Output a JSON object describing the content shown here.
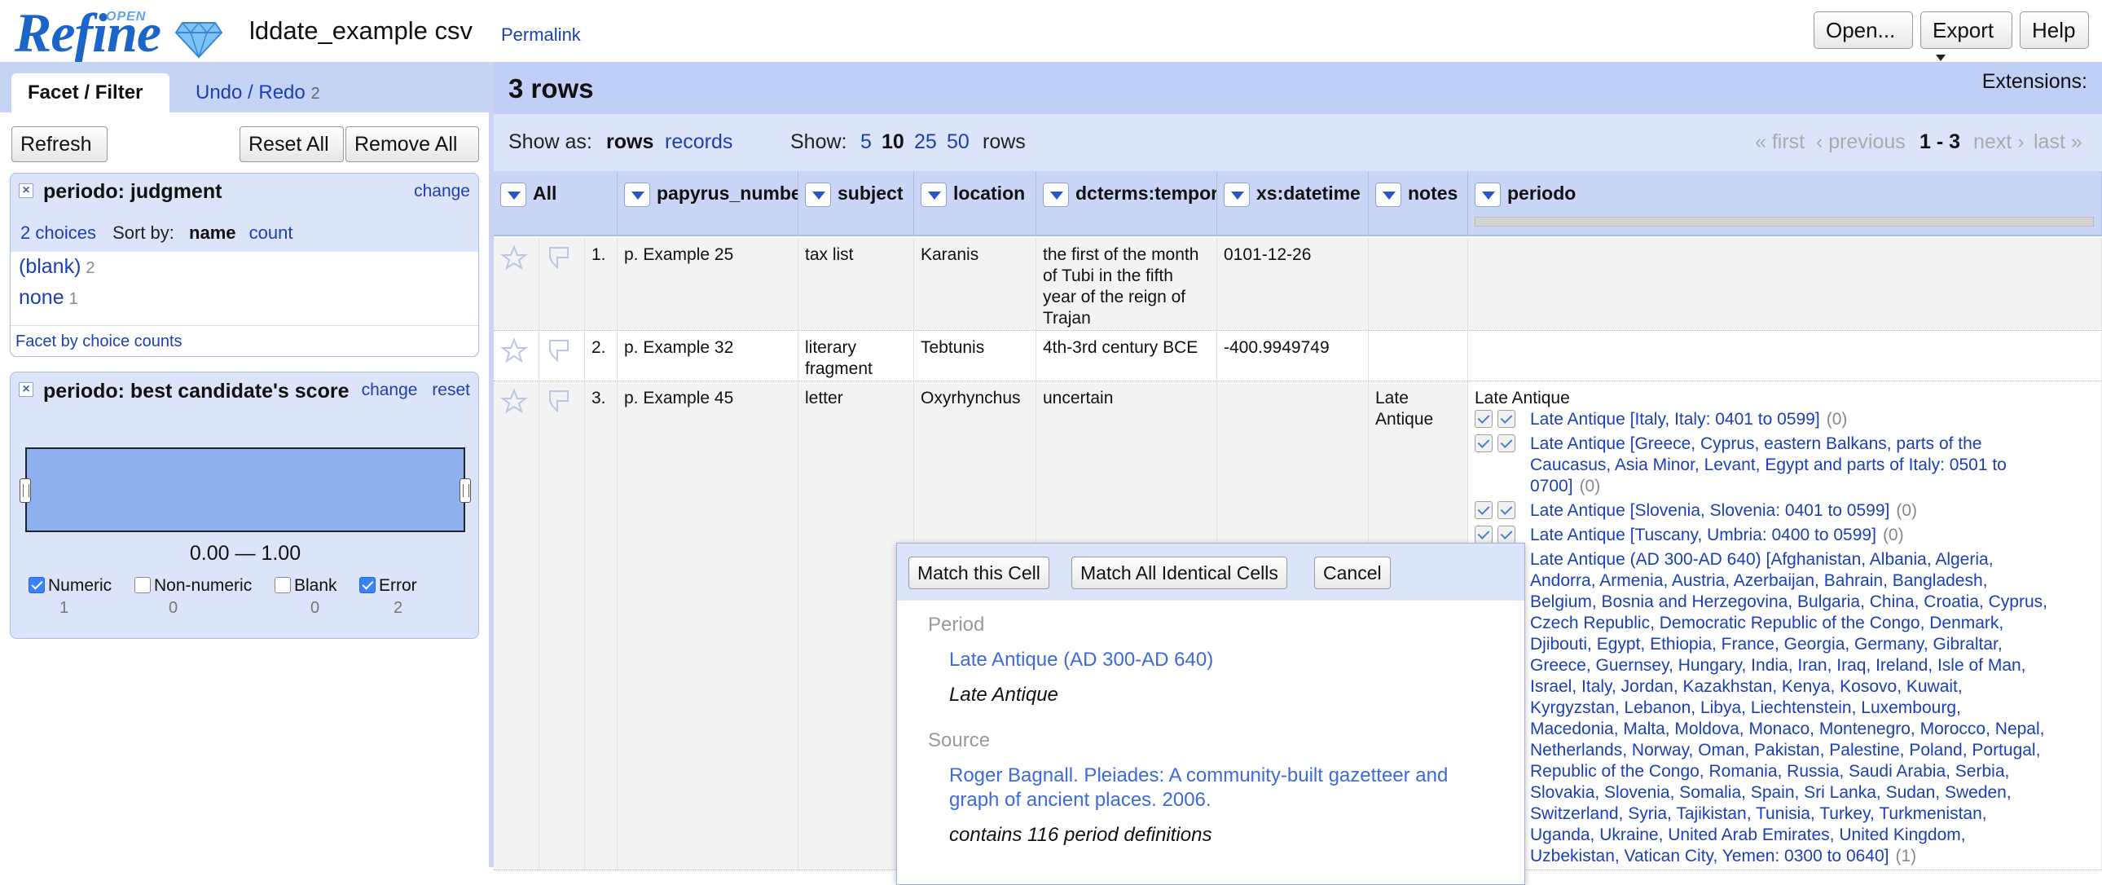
{
  "header": {
    "logo_open": "OPEN",
    "logo_refine": "Refine",
    "project_title": "lddate_example csv",
    "permalink": "Permalink",
    "open_button": "Open...",
    "export_button": "Export",
    "help_button": "Help"
  },
  "left_panel": {
    "tabs": {
      "facet_filter": "Facet / Filter",
      "undo_redo": "Undo / Redo",
      "undo_count": "2"
    },
    "refresh": "Refresh",
    "reset_all": "Reset All",
    "remove_all": "Remove All",
    "facet1": {
      "title": "periodo: judgment",
      "change": "change",
      "choices": "2 choices",
      "sort_by": "Sort by:",
      "sort_name": "name",
      "sort_count": "count",
      "items": [
        {
          "label": "(blank)",
          "count": "2"
        },
        {
          "label": "none",
          "count": "1"
        }
      ],
      "footer": "Facet by choice counts"
    },
    "facet2": {
      "title": "periodo: best candidate's score",
      "change": "change",
      "reset": "reset",
      "range": "0.00 — 1.00",
      "checkboxes": [
        {
          "label": "Numeric",
          "count": "1",
          "checked": true
        },
        {
          "label": "Non-numeric",
          "count": "0",
          "checked": false
        },
        {
          "label": "Blank",
          "count": "0",
          "checked": false
        },
        {
          "label": "Error",
          "count": "2",
          "checked": true
        }
      ]
    }
  },
  "right_panel": {
    "rows_count": "3 rows",
    "extensions": "Extensions:",
    "show_as_label": "Show as:",
    "show_as_rows": "rows",
    "show_as_records": "records",
    "show_label": "Show:",
    "page_sizes": [
      "5",
      "10",
      "25",
      "50"
    ],
    "rows_label": "rows",
    "pager": {
      "first": "« first",
      "previous": "‹ previous",
      "range": "1 - 3",
      "next": "next ›",
      "last": "last »"
    },
    "columns": [
      "All",
      "papyrus_numbe",
      "subject",
      "location",
      "dcterms:tempora",
      "xs:datetime",
      "notes",
      "periodo"
    ],
    "rows": [
      {
        "index": "1.",
        "papyrus": "p. Example 25",
        "subject": "tax list",
        "location": "Karanis",
        "temporal": "the first of the month of Tubi in the fifth year of the reign of Trajan",
        "datetime": "0101-12-26",
        "notes": "",
        "periodo": ""
      },
      {
        "index": "2.",
        "papyrus": "p. Example 32",
        "subject": "literary fragment",
        "location": "Tebtunis",
        "temporal": "4th-3rd century BCE",
        "datetime": "-400.9949749",
        "notes": "",
        "periodo": ""
      },
      {
        "index": "3.",
        "papyrus": "p. Example 45",
        "subject": "letter",
        "location": "Oxyrhynchus",
        "temporal": "uncertain",
        "datetime": "",
        "notes": "Late Antique",
        "periodo": "Late Antique",
        "candidates": [
          {
            "name": "Late Antique [Italy, Italy: 0401 to 0599]",
            "score": "(0)"
          },
          {
            "name": "Late Antique [Greece, Cyprus, eastern Balkans, parts of the Caucasus, Asia Minor, Levant, Egypt and parts of Italy: 0501 to 0700]",
            "score": "(0)"
          },
          {
            "name": "Late Antique [Slovenia, Slovenia: 0401 to 0599]",
            "score": "(0)"
          },
          {
            "name": "Late Antique [Tuscany, Umbria: 0400 to 0599]",
            "score": "(0)"
          },
          {
            "name": "Late Antique (AD 300-AD 640) [Afghanistan, Albania, Algeria, Andorra, Armenia, Austria, Azerbaijan, Bahrain, Bangladesh, Belgium, Bosnia and Herzegovina, Bulgaria, China, Croatia, Cyprus, Czech Republic, Democratic Republic of the Congo, Denmark, Djibouti, Egypt, Ethiopia, France, Georgia, Germany, Gibraltar, Greece, Guernsey, Hungary, India, Iran, Iraq, Ireland, Isle of Man, Israel, Italy, Jordan, Kazakhstan, Kenya, Kosovo, Kuwait, Kyrgyzstan, Lebanon, Libya, Liechtenstein, Luxembourg, Macedonia, Malta, Moldova, Monaco, Montenegro, Morocco, Nepal, Netherlands, Norway, Oman, Pakistan, Palestine, Poland, Portugal, Republic of the Congo, Romania, Russia, Saudi Arabia, Serbia, Slovakia, Slovenia, Somalia, Spain, Sri Lanka, Sudan, Sweden, Switzerland, Syria, Tajikistan, Tunisia, Turkey, Turkmenistan, Uganda, Ukraine, United Arab Emirates, United Kingdom, Uzbekistan, Vatican City, Yemen: 0300 to 0640]",
            "score": "(1)"
          }
        ]
      }
    ]
  },
  "popup": {
    "match_cell": "Match this Cell",
    "match_all": "Match All Identical Cells",
    "cancel": "Cancel",
    "period_label": "Period",
    "period_link": "Late Antique (AD 300-AD 640)",
    "period_italic": "Late Antique",
    "source_label": "Source",
    "source_link": "Roger Bagnall. Pleiades: A community-built gazetteer and graph of ancient places. 2006.",
    "source_italic": "contains 116 period definitions"
  },
  "colors": {
    "accent_link": "#1c3fb4",
    "panel_blue": "#dbe4f9",
    "summary_blue": "#bfcff5",
    "histogram": "#8fb0ef"
  },
  "icons": [
    "diamond-logo-icon",
    "close-icon",
    "star-icon",
    "flag-icon",
    "dropdown-arrow-icon",
    "match-check-icon"
  ]
}
